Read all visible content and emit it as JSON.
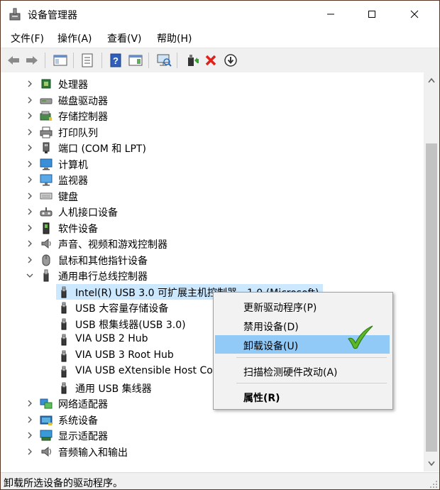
{
  "window": {
    "title": "设备管理器"
  },
  "menu": [
    "文件(F)",
    "操作(A)",
    "查看(V)",
    "帮助(H)"
  ],
  "tree": [
    {
      "label": "处理器",
      "icon": "cpu-icon",
      "expanded": false
    },
    {
      "label": "磁盘驱动器",
      "icon": "disk-icon",
      "expanded": false
    },
    {
      "label": "存储控制器",
      "icon": "storage-controller-icon",
      "expanded": false
    },
    {
      "label": "打印队列",
      "icon": "printer-icon",
      "expanded": false
    },
    {
      "label": "端口 (COM 和 LPT)",
      "icon": "port-icon",
      "expanded": false
    },
    {
      "label": "计算机",
      "icon": "computer-icon",
      "expanded": false
    },
    {
      "label": "监视器",
      "icon": "monitor-icon",
      "expanded": false
    },
    {
      "label": "键盘",
      "icon": "keyboard-icon",
      "expanded": false
    },
    {
      "label": "人机接口设备",
      "icon": "hid-icon",
      "expanded": false
    },
    {
      "label": "软件设备",
      "icon": "software-device-icon",
      "expanded": false
    },
    {
      "label": "声音、视频和游戏控制器",
      "icon": "speaker-icon",
      "expanded": false
    },
    {
      "label": "鼠标和其他指针设备",
      "icon": "mouse-icon",
      "expanded": false
    },
    {
      "label": "通用串行总线控制器",
      "icon": "usb-icon",
      "expanded": true
    },
    {
      "label": "Intel(R) USB 3.0 可扩展主机控制器 - 1.0 (Microsoft)",
      "icon": "usb-plug-icon",
      "child": true,
      "selected": true
    },
    {
      "label": "USB 大容量存储设备",
      "icon": "usb-plug-icon",
      "child": true
    },
    {
      "label": "USB 根集线器(USB 3.0)",
      "icon": "usb-plug-icon",
      "child": true
    },
    {
      "label": "VIA USB 2 Hub",
      "icon": "usb-plug-icon",
      "child": true
    },
    {
      "label": "VIA USB 3 Root Hub",
      "icon": "usb-plug-icon",
      "child": true
    },
    {
      "label": "VIA USB eXtensible Host Controller",
      "icon": "usb-plug-icon",
      "child": true
    },
    {
      "label": "通用 USB 集线器",
      "icon": "usb-plug-icon",
      "child": true
    },
    {
      "label": "网络适配器",
      "icon": "network-icon",
      "expanded": false
    },
    {
      "label": "系统设备",
      "icon": "system-device-icon",
      "expanded": false
    },
    {
      "label": "显示适配器",
      "icon": "display-adapter-icon",
      "expanded": false
    },
    {
      "label": "音频输入和输出",
      "icon": "audio-icon",
      "expanded": false
    }
  ],
  "context_menu": {
    "items": [
      {
        "label": "更新驱动程序(P)"
      },
      {
        "label": "禁用设备(D)"
      },
      {
        "label": "卸载设备(U)",
        "highlighted": true
      },
      {
        "label": "扫描检测硬件改动(A)"
      },
      {
        "label": "属性(R)",
        "bold": true
      }
    ]
  },
  "status": "卸载所选设备的驱动程序。",
  "colors": {
    "selection": "#cce8ff",
    "menu_highlight": "#91c9f7",
    "window_border": "#5a3526",
    "check": "#5cb82a"
  }
}
